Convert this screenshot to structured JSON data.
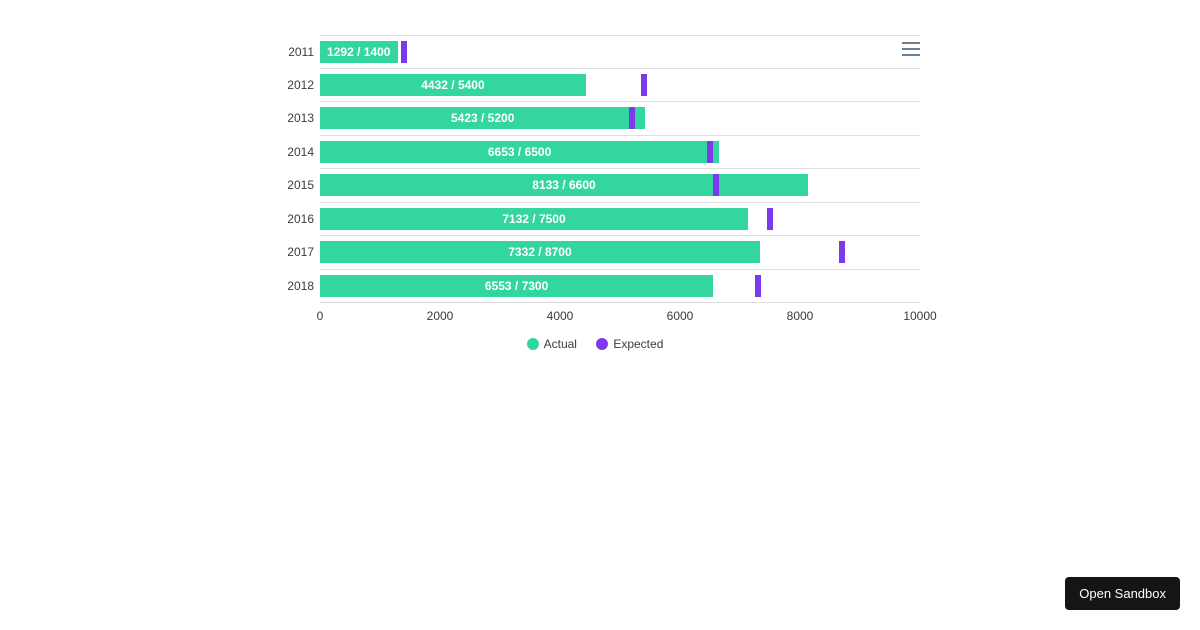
{
  "chart_data": {
    "type": "bar",
    "orientation": "horizontal",
    "categories": [
      "2011",
      "2012",
      "2013",
      "2014",
      "2015",
      "2016",
      "2017",
      "2018"
    ],
    "series": [
      {
        "name": "Actual",
        "values": [
          1292,
          4432,
          5423,
          6653,
          8133,
          7132,
          7332,
          6553
        ],
        "color": "#33d69f"
      },
      {
        "name": "Expected",
        "values": [
          1400,
          5400,
          5200,
          6500,
          6600,
          7500,
          8700,
          7300
        ],
        "color": "#7c3aed"
      }
    ],
    "data_labels": [
      "1292 / 1400",
      "4432 / 5400",
      "5423 / 5200",
      "6653 / 6500",
      "8133 / 6600",
      "7132 / 7500",
      "7332 / 8700",
      "6553 / 7300"
    ],
    "xaxis": {
      "min": 0,
      "max": 10000,
      "ticks": [
        0,
        2000,
        4000,
        6000,
        8000,
        10000
      ]
    },
    "title": "",
    "xlabel": "",
    "ylabel": ""
  },
  "footer": {
    "open_sandbox": "Open Sandbox"
  }
}
